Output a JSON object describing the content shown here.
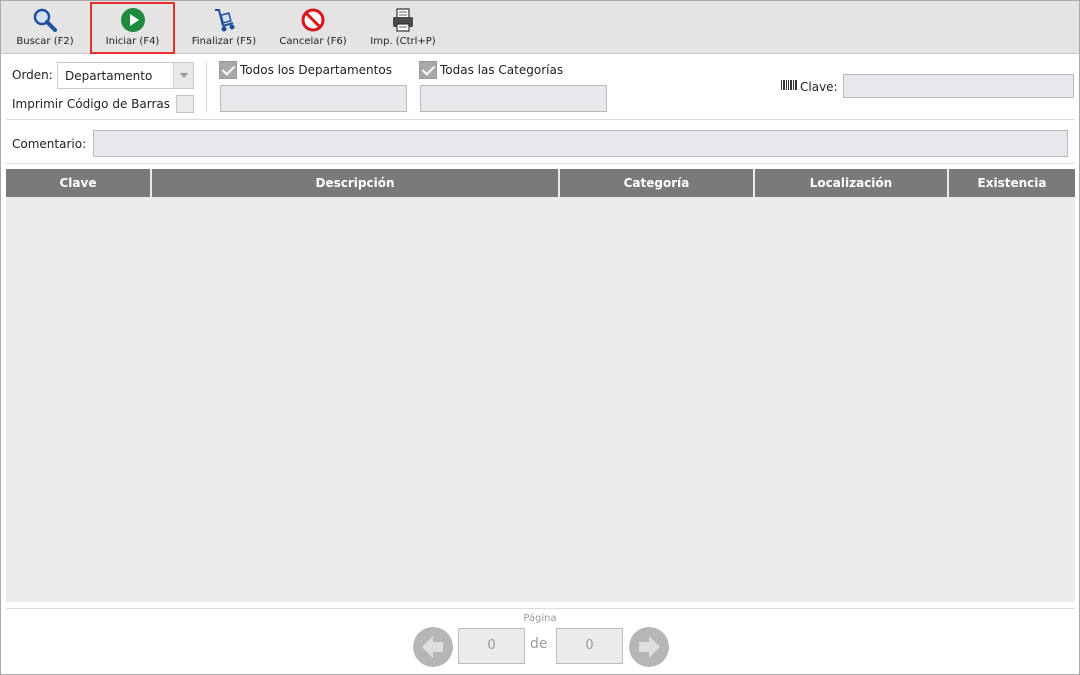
{
  "toolbar": {
    "buttons": [
      {
        "label": "Buscar (F2)",
        "icon": "search-icon",
        "selected": false
      },
      {
        "label": "Iniciar (F4)",
        "icon": "play-icon",
        "selected": true
      },
      {
        "label": "Finalizar (F5)",
        "icon": "hand-truck-icon",
        "selected": false
      },
      {
        "label": "Cancelar (F6)",
        "icon": "cancel-icon",
        "selected": false
      },
      {
        "label": "Imp. (Ctrl+P)",
        "icon": "printer-icon",
        "selected": false
      }
    ]
  },
  "filters": {
    "orden_label": "Orden:",
    "orden_value": "Departamento",
    "barcode_label": "Imprimir Código de Barras",
    "barcode_checked": false,
    "all_departments_label": "Todos los Departamentos",
    "all_departments_checked": true,
    "department_value": "",
    "all_categories_label": "Todas las Categorías",
    "all_categories_checked": true,
    "category_value": "",
    "clave_label": "Clave:",
    "clave_value": "",
    "comment_label": "Comentario:",
    "comment_value": ""
  },
  "table": {
    "columns": [
      "Clave",
      "Descripción",
      "Categoría",
      "Localización",
      "Existencia"
    ],
    "rows": []
  },
  "pagination": {
    "label": "Página",
    "current": "0",
    "of_label": "de",
    "total": "0"
  },
  "colors": {
    "accent_selected_border": "#e53030",
    "header_bg": "#7a7a7a",
    "toolbar_bg": "#e4e4e4"
  }
}
